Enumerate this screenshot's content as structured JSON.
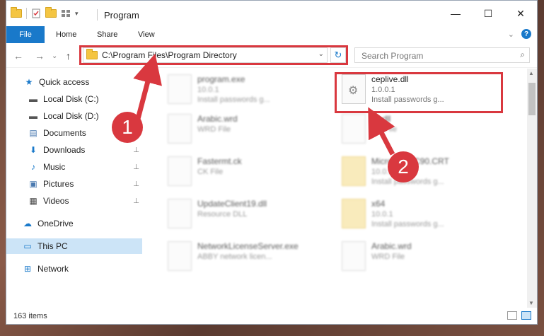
{
  "window": {
    "title": "Program",
    "buttons": {
      "minimize": "—",
      "maximize": "☐",
      "close": "✕"
    }
  },
  "ribbon": {
    "file_tab": "File",
    "tabs": [
      "Home",
      "Share",
      "View"
    ],
    "expand_glyph": "⌄",
    "help_glyph": "?"
  },
  "navigation": {
    "back": "←",
    "forward": "→",
    "recent": "⌄",
    "up": "↑",
    "address": "C:\\Program Files\\Program Directory",
    "address_dropdown": "⌄",
    "refresh": "↻",
    "search_placeholder": "Search Program"
  },
  "sidebar": {
    "items": [
      {
        "label": "Quick access",
        "icon": "star-icon",
        "glyph": "★",
        "color": "#1979ca"
      },
      {
        "label": "Local Disk (C:)",
        "icon": "drive-icon",
        "glyph": "▬",
        "color": "#555",
        "pinned": false
      },
      {
        "label": "Local Disk (D:)",
        "icon": "drive-icon",
        "glyph": "▬",
        "color": "#555"
      },
      {
        "label": "Documents",
        "icon": "documents-icon",
        "glyph": "▤",
        "color": "#4a7ab0"
      },
      {
        "label": "Downloads",
        "icon": "downloads-icon",
        "glyph": "⬇",
        "color": "#1979ca"
      },
      {
        "label": "Music",
        "icon": "music-icon",
        "glyph": "♪",
        "color": "#1979ca"
      },
      {
        "label": "Pictures",
        "icon": "pictures-icon",
        "glyph": "▣",
        "color": "#4a7ab0"
      },
      {
        "label": "Videos",
        "icon": "videos-icon",
        "glyph": "▦",
        "color": "#444"
      },
      {
        "label": "OneDrive",
        "icon": "cloud-icon",
        "glyph": "☁",
        "color": "#1979ca"
      },
      {
        "label": "This PC",
        "icon": "computer-icon",
        "glyph": "▭",
        "color": "#1979ca"
      },
      {
        "label": "Network",
        "icon": "network-icon",
        "glyph": "⊞",
        "color": "#1979ca"
      }
    ],
    "pin_glyph": "📌"
  },
  "files": [
    {
      "name": "program.exe",
      "line2": "10.0.1",
      "line3": "Install passwords g...",
      "blurred": true
    },
    {
      "name": "ceplive.dll",
      "line2": "1.0.0.1",
      "line3": "Install passwords g...",
      "blurred": false
    },
    {
      "name": "Arabic.wrd",
      "line2": "WRD File",
      "line3": "",
      "blurred": true
    },
    {
      "name": "ck.dll",
      "line2": "CK File",
      "line3": "",
      "blurred": true
    },
    {
      "name": "Fastermt.ck",
      "line2": "CK File",
      "line3": "",
      "blurred": true
    },
    {
      "name": "Microsoft.VC90.CRT",
      "line2": "10.0.1",
      "line3": "Install passwords g...",
      "blurred": true
    },
    {
      "name": "UpdateClient19.dll",
      "line2": "Resource DLL",
      "line3": "",
      "blurred": true
    },
    {
      "name": "x64",
      "line2": "10.0.1",
      "line3": "Install passwords g...",
      "blurred": true
    },
    {
      "name": "NetworkLicenseServer.exe",
      "line2": "ABBY network licen...",
      "line3": "",
      "blurred": true
    },
    {
      "name": "Arabic.wrd",
      "line2": "WRD File",
      "line3": "",
      "blurred": true
    }
  ],
  "status": {
    "item_count": "163 items"
  },
  "callouts": {
    "one": "1",
    "two": "2"
  },
  "colors": {
    "accent": "#1979ca",
    "highlight": "#d9383f",
    "selected": "#cce4f7"
  }
}
